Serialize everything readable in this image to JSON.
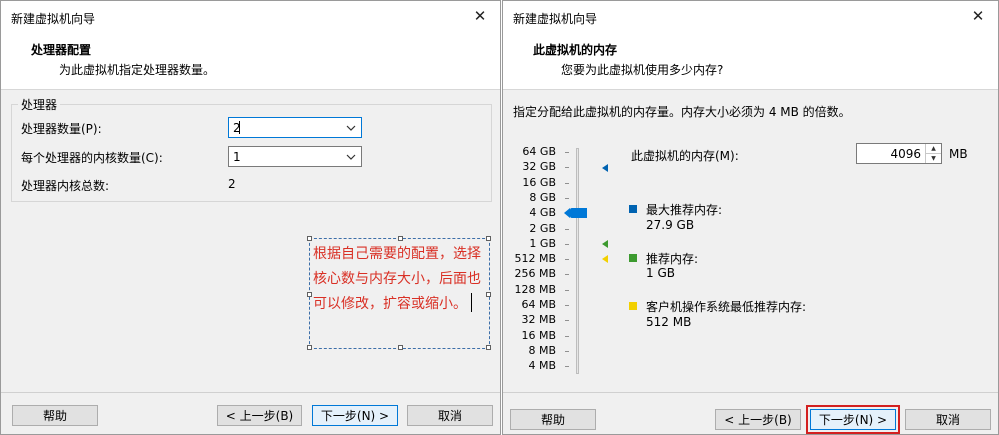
{
  "left_dialog": {
    "title": "新建虚拟机向导",
    "close_glyph": "✕",
    "header_title": "处理器配置",
    "header_subtitle": "为此虚拟机指定处理器数量。",
    "group_title": "处理器",
    "processor_count_label": "处理器数量(P):",
    "processor_count_value": "2",
    "cores_per_processor_label": "每个处理器的内核数量(C):",
    "cores_per_processor_value": "1",
    "total_cores_label": "处理器内核总数:",
    "total_cores_value": "2",
    "annotation_text": "根据自己需要的配置，选择核心数与内存大小，后面也可以修改，扩容或缩小。",
    "buttons": {
      "help": "帮助",
      "back": "< 上一步(B)",
      "next": "下一步(N) >",
      "cancel": "取消"
    }
  },
  "right_dialog": {
    "title": "新建虚拟机向导",
    "close_glyph": "✕",
    "header_title": "此虚拟机的内存",
    "header_subtitle": "您要为此虚拟机使用多少内存?",
    "instruction": "指定分配给此虚拟机的内存量。内存大小必须为 4 MB 的倍数。",
    "memory_label": "此虚拟机的内存(M):",
    "memory_value": "4096",
    "memory_unit": "MB",
    "scale_labels": [
      "64 GB",
      "32 GB",
      "16 GB",
      "8 GB",
      "4 GB",
      "2 GB",
      "1 GB",
      "512 MB",
      "256 MB",
      "128 MB",
      "64 MB",
      "32 MB",
      "16 MB",
      "8 MB",
      "4 MB"
    ],
    "max_recommended": {
      "label": "最大推荐内存:",
      "value": "27.9 GB",
      "color": "#0063b1"
    },
    "recommended": {
      "label": "推荐内存:",
      "value": "1 GB",
      "color": "#3c9a2f"
    },
    "guest_min": {
      "label": "客户机操作系统最低推荐内存:",
      "value": "512 MB",
      "color": "#f2d000"
    },
    "slider_color": "#0078d7",
    "buttons": {
      "help": "帮助",
      "back": "< 上一步(B)",
      "next": "下一步(N) >",
      "cancel": "取消"
    }
  }
}
